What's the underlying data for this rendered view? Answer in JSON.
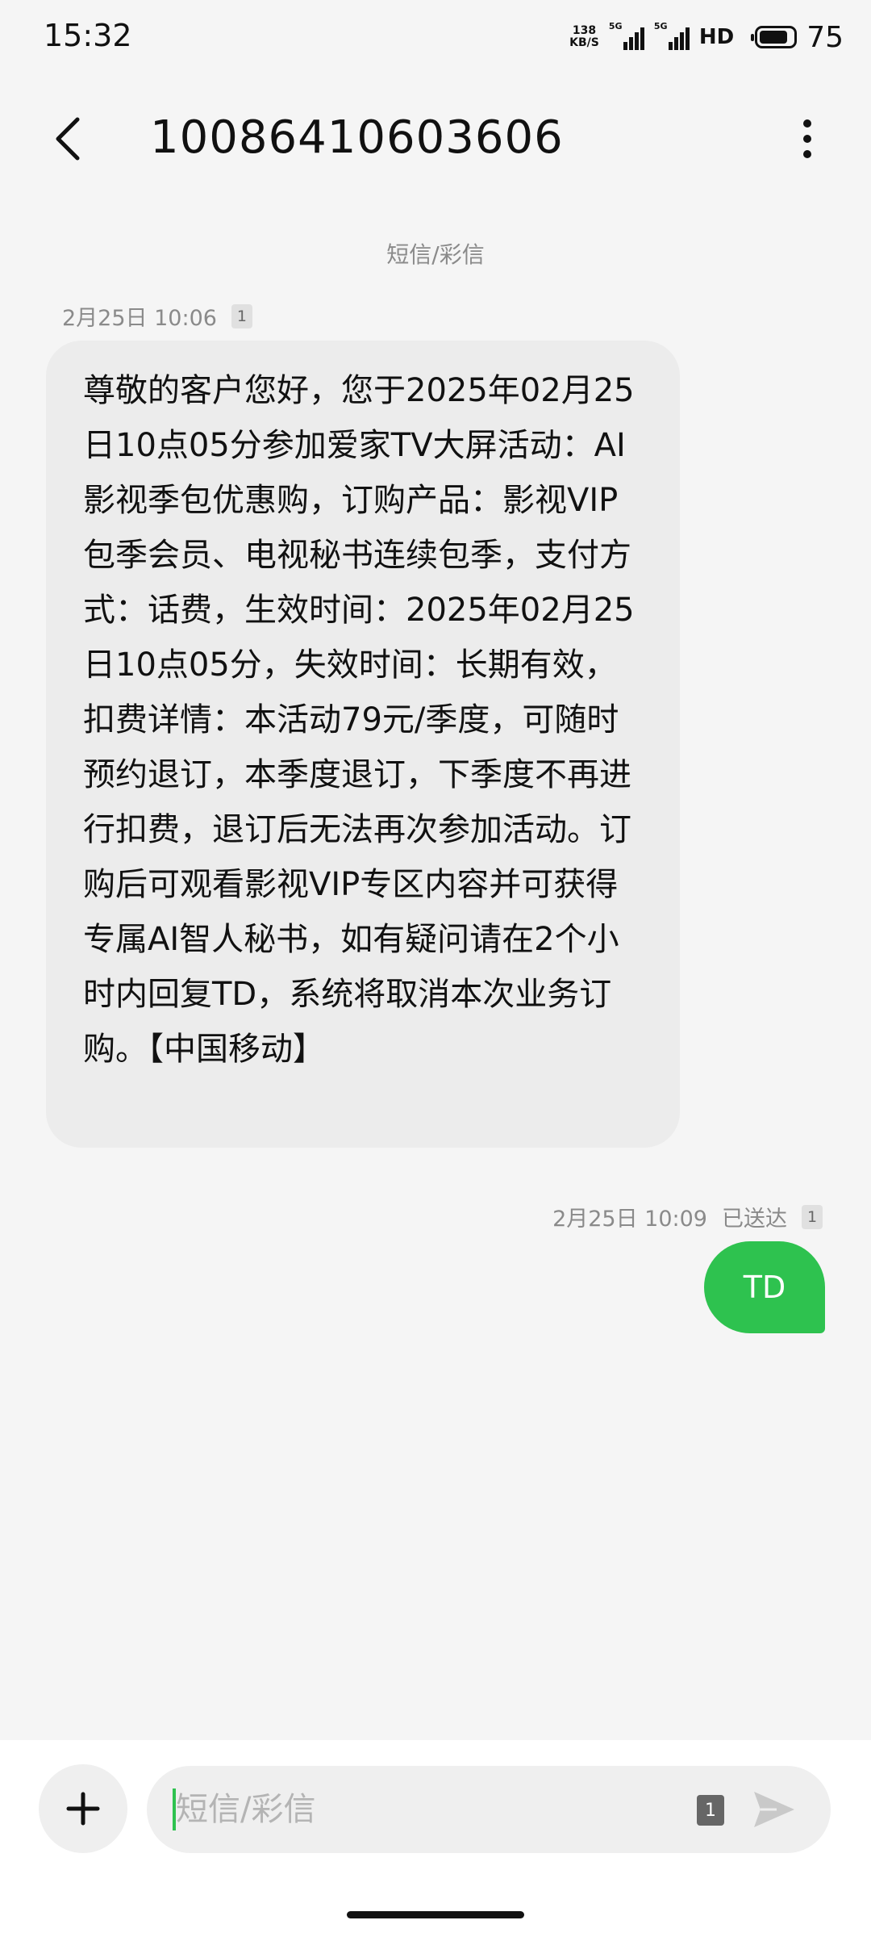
{
  "status_bar": {
    "time": "15:32",
    "net_speed_value": "138",
    "net_speed_unit": "KB/S",
    "sim1_label": "5G",
    "sim2_label": "5G",
    "hd_label": "HD",
    "battery_percent": "75"
  },
  "header": {
    "title": "10086410603606",
    "back_icon": "chevron-left-icon",
    "more_icon": "more-vertical-icon"
  },
  "conversation": {
    "message_type_label": "短信/彩信",
    "incoming": {
      "timestamp": "2月25日 10:06",
      "sim": "1",
      "text": "尊敬的客户您好，您于2025年02月25日10点05分参加爱家TV大屏活动：AI影视季包优惠购，订购产品：影视VIP包季会员、电视秘书连续包季，支付方式：话费，生效时间：2025年02月25日10点05分，失效时间：长期有效，扣费详情：本活动79元/季度，可随时预约退订，本季度退订，下季度不再进行扣费，退订后无法再次参加活动。订购后可观看影视VIP专区内容并可获得专属AI智人秘书，如有疑问请在2个小时内回复TD，系统将取消本次业务订购。【中国移动】"
    },
    "outgoing": {
      "timestamp": "2月25日 10:09",
      "status": "已送达",
      "sim": "1",
      "text": "TD"
    }
  },
  "composer": {
    "placeholder": "短信/彩信",
    "sim": "1",
    "add_icon": "plus-icon",
    "send_icon": "send-icon"
  },
  "colors": {
    "accent_green": "#2ec24f",
    "background": "#f5f5f5",
    "incoming_bubble": "#ececec"
  }
}
